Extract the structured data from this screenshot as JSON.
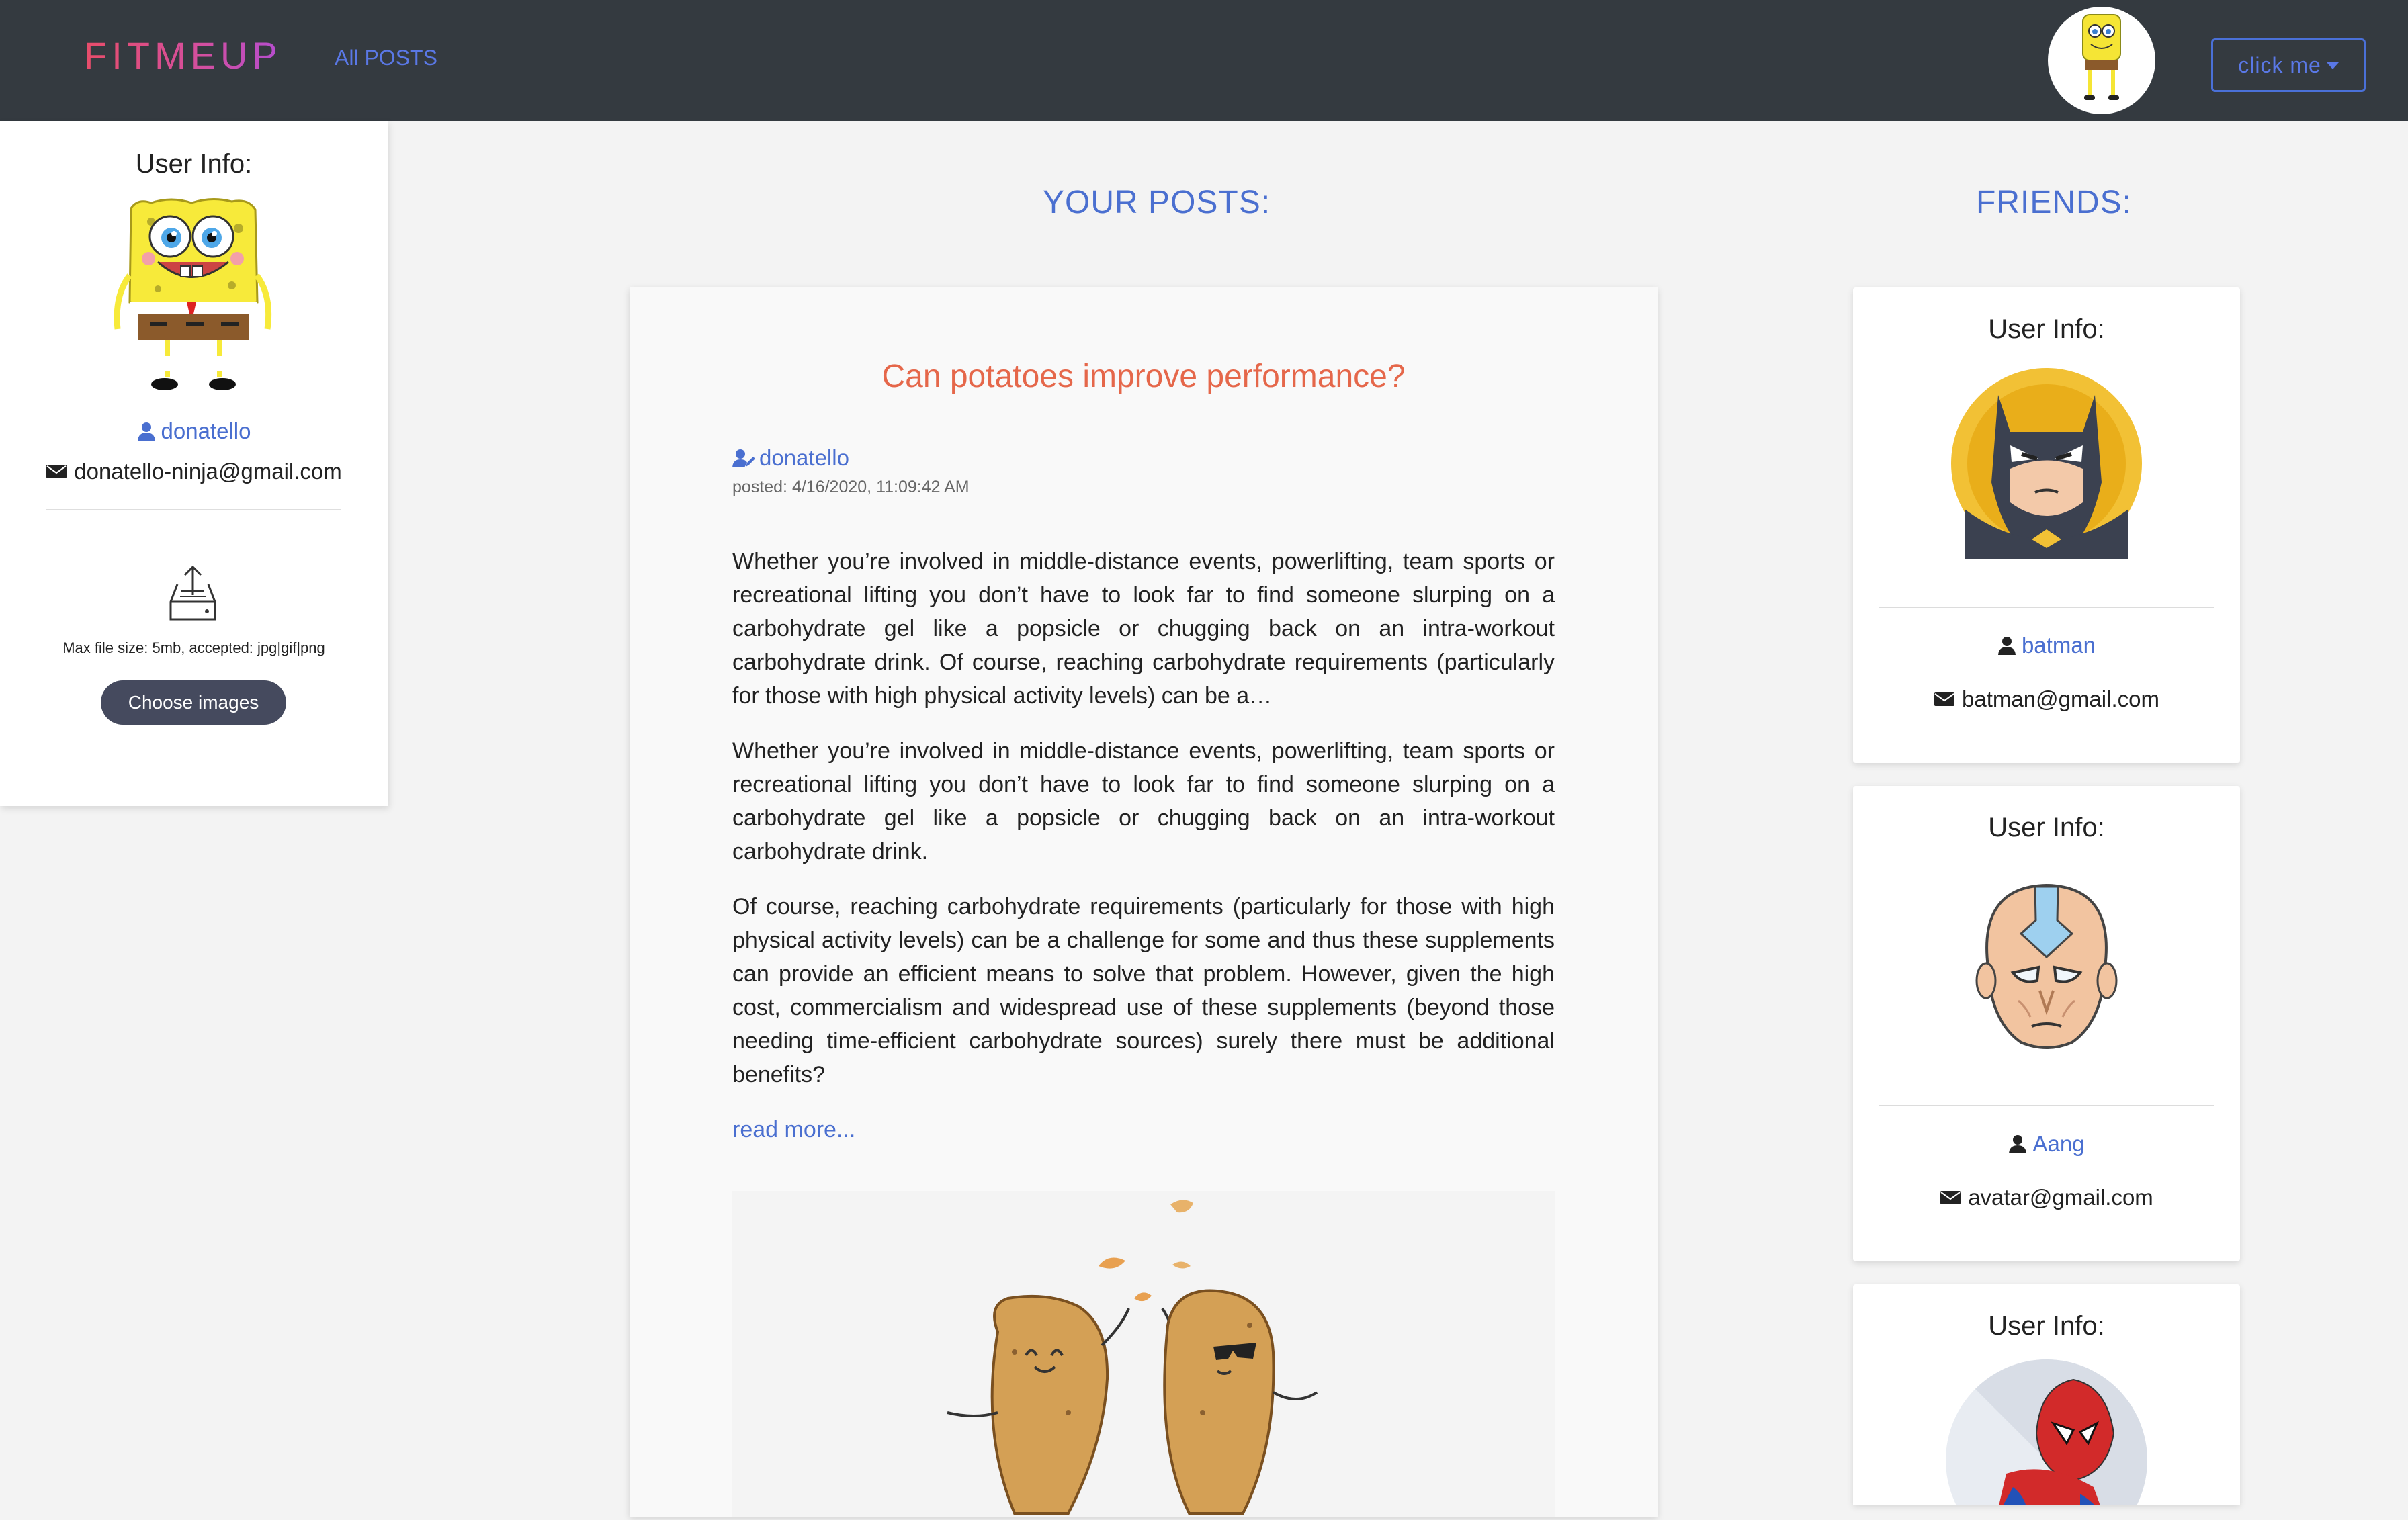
{
  "navbar": {
    "brand": "FITMEUP",
    "nav_link": "All POSTS",
    "dropdown_label": "click me"
  },
  "user_card": {
    "title": "User Info:",
    "username": "donatello",
    "email": "donatello-ninja@gmail.com",
    "upload_hint": "Max file size: 5mb, accepted: jpg|gif|png",
    "choose_button": "Choose images"
  },
  "posts_heading": "YOUR POSTS:",
  "friends_heading": "FRIENDS:",
  "post": {
    "title": "Can potatoes improve performance?",
    "author": "donatello",
    "posted": "posted: 4/16/2020, 11:09:42 AM",
    "excerpt": "Whether you’re involved in middle-distance events, powerlifting, team sports or recreational lifting you don’t have to look far to find someone slurping on a carbohydrate gel like a popsicle or chugging back on an intra-workout carbohydrate drink.   Of course, reaching carbohydrate requirements (particularly for those with high physical activity levels) can be a…",
    "paragraph_1": "Whether you’re involved in middle-distance events, powerlifting, team sports or recreational lifting you don’t have to look far to find someone slurping on a carbohydrate gel like a popsicle or chugging back on an intra-workout carbohydrate drink.",
    "paragraph_2": "Of course, reaching carbohydrate requirements (particularly for those with high physical activity levels) can be a challenge for some and thus these supplements can provide an efficient means to solve that problem. However, given the high cost, commercialism and widespread use of these supplements (beyond those needing time-efficient carbohydrate sources) surely there must be additional benefits?",
    "read_more": "read more..."
  },
  "friends": [
    {
      "title": "User Info:",
      "name": "batman",
      "email": "batman@gmail.com"
    },
    {
      "title": "User Info:",
      "name": "Aang",
      "email": "avatar@gmail.com"
    },
    {
      "title": "User Info:"
    }
  ],
  "colors": {
    "navbar": "#343a40",
    "link": "#4a6fd0",
    "post_title": "#e5674a",
    "button": "#454a5e"
  }
}
